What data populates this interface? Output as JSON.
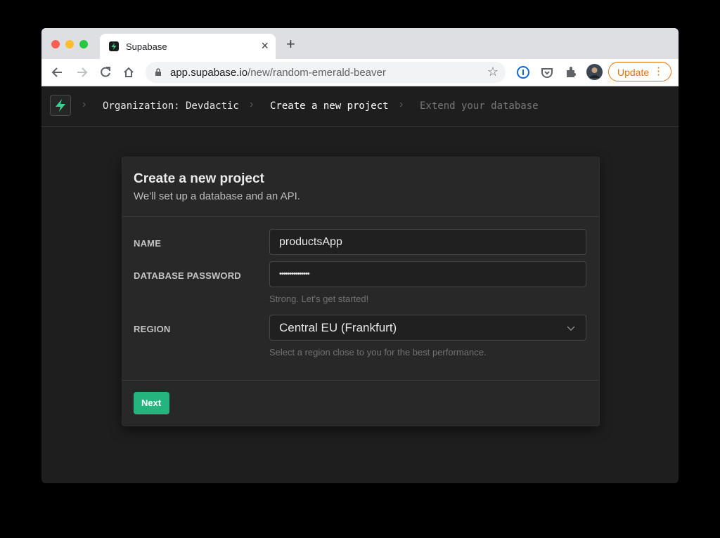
{
  "browser": {
    "tab_title": "Supabase",
    "tab_close": "×",
    "new_tab": "+",
    "url_host": "app.supabase.io",
    "url_path": "/new/random-emerald-beaver",
    "update_label": "Update",
    "update_menu": "⋮",
    "icons": [
      "back-icon",
      "forward-icon",
      "reload-icon",
      "home-icon",
      "lock-icon",
      "star-icon",
      "password-manager-icon",
      "pocket-icon",
      "extensions-icon",
      "profile-avatar"
    ]
  },
  "breadcrumb": {
    "org": "Organization: Devdactic",
    "current": "Create a new project",
    "next": "Extend your database",
    "separator": "›"
  },
  "card": {
    "title": "Create a new project",
    "subtitle": "We'll set up a database and an API."
  },
  "form": {
    "name_label": "NAME",
    "name_value": "productsApp",
    "password_label": "DATABASE PASSWORD",
    "password_value": "•••••••••••••••",
    "password_hint": "Strong. Let's get started!",
    "region_label": "REGION",
    "region_value": "Central EU (Frankfurt)",
    "region_hint": "Select a region close to you for the best performance.",
    "next_label": "Next"
  },
  "colors": {
    "brand": "#24b47e",
    "update_orange": "#e8710a"
  }
}
